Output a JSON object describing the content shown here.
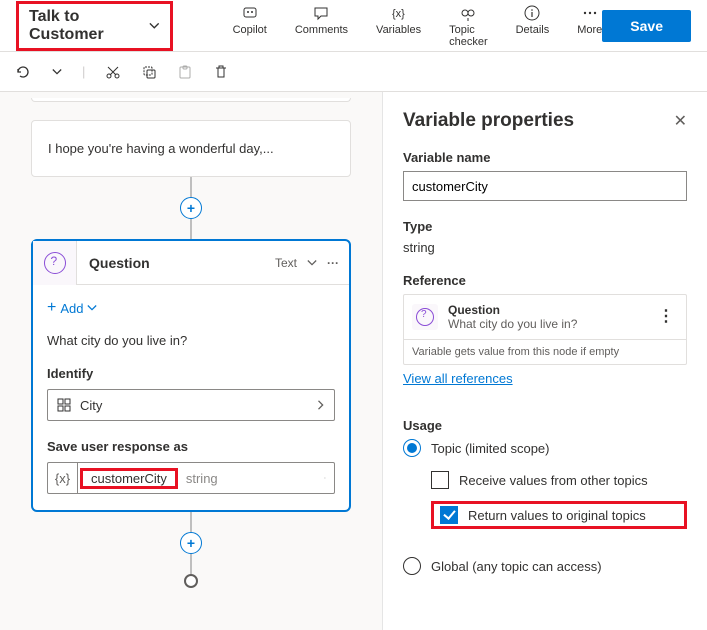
{
  "header": {
    "topic_name": "Talk to Customer",
    "tools": {
      "copilot": "Copilot",
      "comments": "Comments",
      "variables": "Variables",
      "topic_checker": "Topic checker",
      "details": "Details",
      "more": "More"
    },
    "save": "Save"
  },
  "canvas": {
    "message_text": "I hope you're having a wonderful day,...",
    "question": {
      "title": "Question",
      "head_type": "Text",
      "add": "Add",
      "text": "What city do you live in?",
      "identify_label": "Identify",
      "identify_value": "City",
      "save_label": "Save user response as",
      "var_name": "customerCity",
      "var_type": "string"
    }
  },
  "panel": {
    "title": "Variable properties",
    "name_label": "Variable name",
    "name_value": "customerCity",
    "type_label": "Type",
    "type_value": "string",
    "reference_label": "Reference",
    "ref_title": "Question",
    "ref_sub": "What city do you live in?",
    "ref_foot": "Variable gets value from this node if empty",
    "view_all": "View all references",
    "usage_label": "Usage",
    "topic_scope": "Topic (limited scope)",
    "receive": "Receive values from other topics",
    "return": "Return values to original topics",
    "global": "Global (any topic can access)"
  }
}
